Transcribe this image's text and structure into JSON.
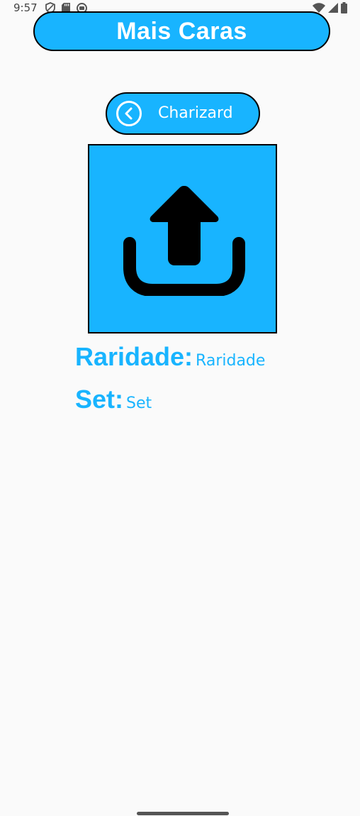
{
  "status_bar": {
    "time": "9:57",
    "left_icons": [
      "shield-icon",
      "sd-card-icon",
      "media-icon"
    ],
    "right_icons": [
      "wifi-icon",
      "signal-icon",
      "battery-icon"
    ]
  },
  "header": {
    "title": "Mais Caras"
  },
  "card": {
    "name": "Charizard",
    "back_icon": "chevron-left-circle-icon",
    "image_placeholder_icon": "upload-icon",
    "fields": [
      {
        "label": "Raridade:",
        "value": "Raridade"
      },
      {
        "label": "Set:",
        "value": "Set"
      }
    ]
  },
  "colors": {
    "accent": "#18B4FF",
    "background": "#FAFAFA",
    "text_on_accent": "#FFFFFF",
    "border": "#000000"
  }
}
